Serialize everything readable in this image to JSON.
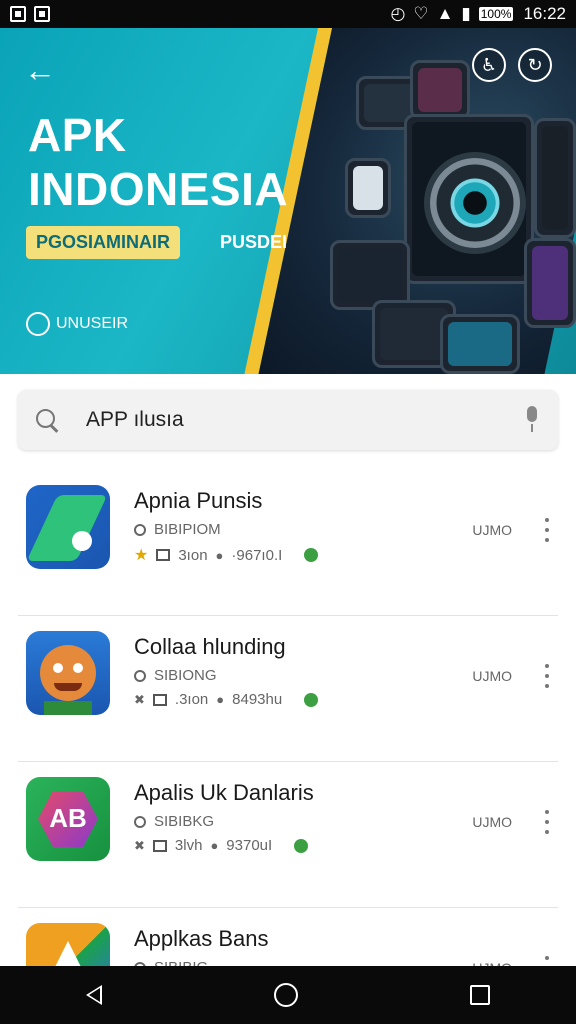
{
  "status_bar": {
    "time": "16:22",
    "battery": "100%",
    "icons": [
      "notification-icon",
      "image-icon",
      "alarm-icon",
      "vibrate-icon",
      "wifi-icon",
      "signal-icon",
      "battery-icon"
    ]
  },
  "banner": {
    "title_line1": "APK",
    "title_line2": "INDONESIA",
    "tag": "PGOSIAMINAIR",
    "tag2": "PUSDEI",
    "foot_text": "UNUSEIR",
    "colors": {
      "bg": "#1bb7c6",
      "accent": "#f2c230",
      "tag_bg": "#f4e07a"
    }
  },
  "search": {
    "value": "APP ılusıa",
    "placeholder": ""
  },
  "apps": [
    {
      "name": "Apnia Punsis",
      "sub": "BIBIPIOM",
      "meta1": "3ıon",
      "meta2": "·967ı0.I",
      "size": "UJMO",
      "icon_colors": [
        "#1f66c8",
        "#23a35a"
      ],
      "icon_glyph": ""
    },
    {
      "name": "Collaa hlunding",
      "sub": "SIBIONG",
      "meta1": ".3ıon",
      "meta2": "8493hu",
      "size": "UJMO",
      "icon_colors": [
        "#2a5bd7",
        "#f08a2a"
      ],
      "icon_glyph": ""
    },
    {
      "name": "Apalis Uk Danlaris",
      "sub": "SIBIBKG",
      "meta1": "3lvh",
      "meta2": "9370uI",
      "size": "UJMO",
      "icon_colors": [
        "#1aa24a",
        "#c23b7a"
      ],
      "icon_glyph": "AB"
    },
    {
      "name": "Applkas Bans",
      "sub": "SIBIBIG",
      "meta1": "",
      "meta2": "",
      "size": "UJMO",
      "icon_colors": [
        "#1aa24a",
        "#f0a020"
      ],
      "icon_glyph": ""
    }
  ]
}
